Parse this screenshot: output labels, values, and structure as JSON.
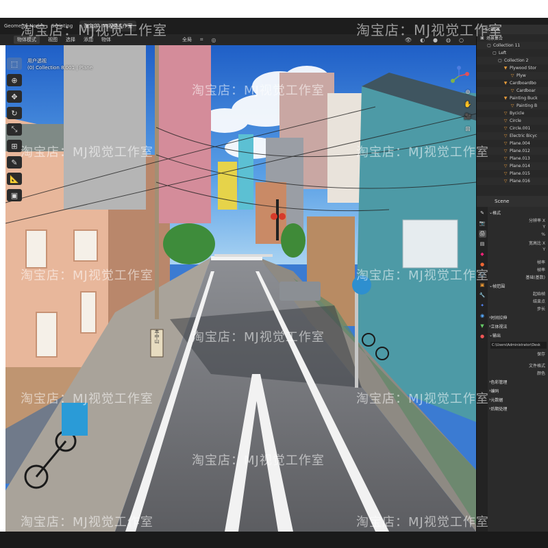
{
  "topbar": {
    "tabs": [
      "Geometry Nodes",
      "Scripting",
      "淘宝店：MJ视觉工作室"
    ],
    "active_tab": "淘宝店：MJ视觉工作室"
  },
  "header": {
    "mode": "物体模式",
    "menus": [
      "视图",
      "选择",
      "添加",
      "物体"
    ],
    "transform": "全局",
    "select_label": "选项"
  },
  "viewport": {
    "view_name": "用户透视",
    "collection_info": "(0) Collection 8.001 | Plane",
    "sign_text": "本中山"
  },
  "outliner": {
    "title": "Scene",
    "rows": [
      "场景集合",
      "Collection 11",
      "Left",
      "Collection 2",
      "Plywood Stor",
      "Plyw",
      "Cardboardbo",
      "Cardboar",
      "Painting Buck",
      "Painting B",
      "Bycicle",
      "Circle",
      "Circle.001",
      "Electric Bicyc",
      "Plane.004",
      "Plane.012",
      "Plane.013",
      "Plane.014",
      "Plane.015",
      "Plane.016"
    ]
  },
  "properties": {
    "title": "Scene",
    "sections": {
      "format": "格式",
      "resolution_label": "分辨率 X",
      "resolution_y": "Y",
      "percent": "%",
      "aspect_label": "宽高比 X",
      "aspect_y": "Y",
      "frame_rate": "帧率",
      "frame_rate2": "帧率",
      "base": "基础(基数)",
      "frame_range": "帧范围",
      "frame_start": "起始帧",
      "frame_end": "结束点",
      "frame_step": "步长",
      "time_stretch": "时间拉伸",
      "stereo": "立体视法",
      "output": "输出",
      "output_path": "C:\\Users\\Administrator\\Desk",
      "save": "保存",
      "file_format": "文件格式",
      "color": "颜色",
      "color_mgmt": "色彩管理",
      "encoding": "编码",
      "metadata": "元数据",
      "post": "后期处理"
    }
  },
  "watermark": "淘宝店：MJ视觉工作室",
  "colors": {
    "ui_dark": "#1d1d1d",
    "panel": "#2b2b2b",
    "accent": "#4772b3",
    "sky": "#3b7bd2",
    "road": "#6e6f73"
  }
}
